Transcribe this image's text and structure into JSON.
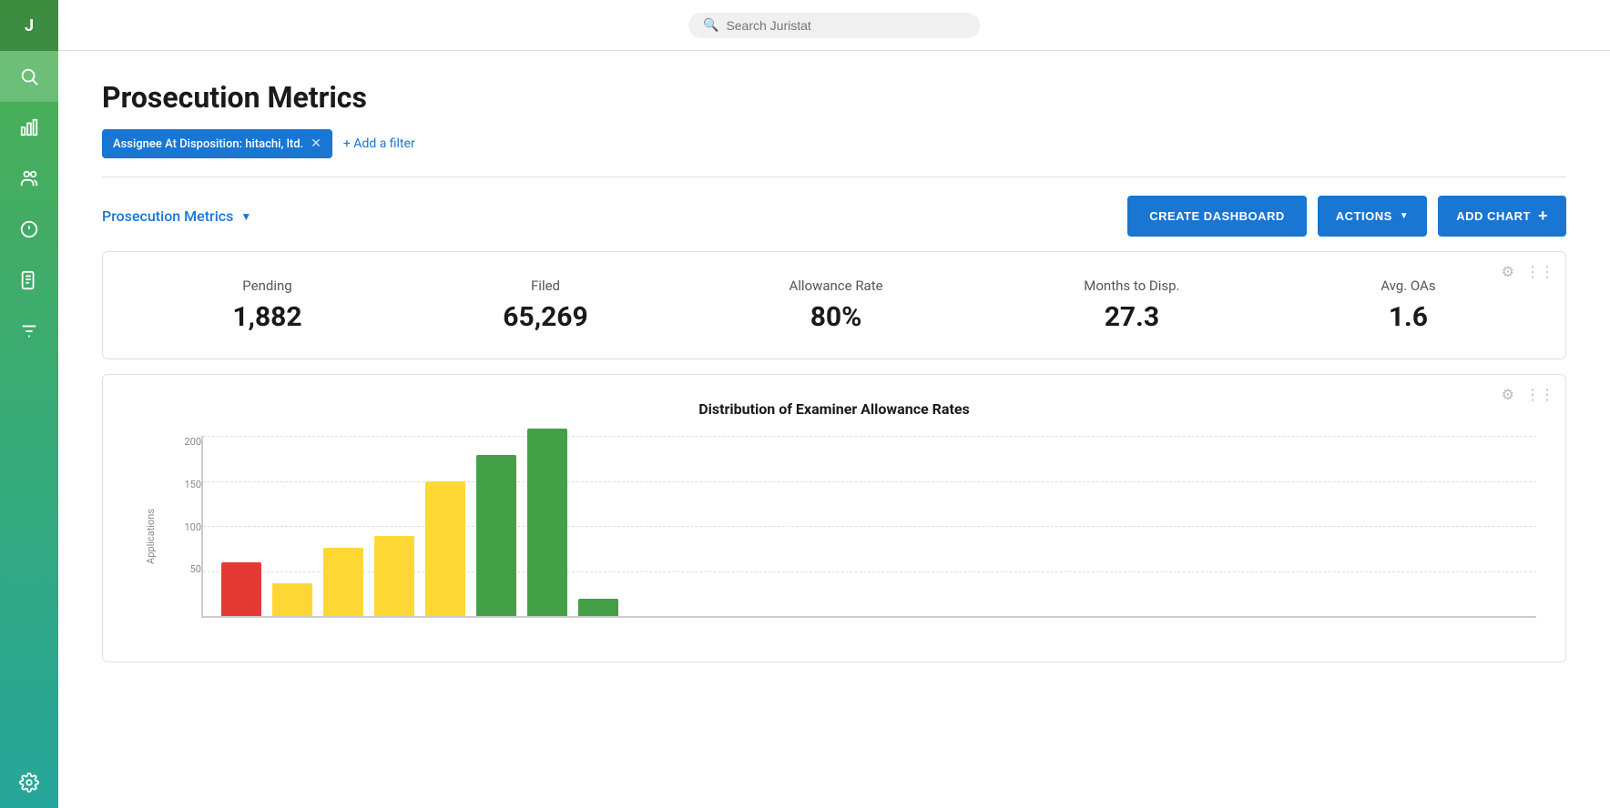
{
  "app": {
    "user_initial": "J"
  },
  "topbar": {
    "search_placeholder": "Search Juristat"
  },
  "page": {
    "title": "Prosecution Metrics"
  },
  "filters": {
    "active_filter_label": "Assignee At Disposition: hitachi, ltd.",
    "add_filter_label": "+ Add a filter"
  },
  "toolbar": {
    "tab_label": "Prosecution Metrics",
    "create_dashboard_label": "CREATE DASHBOARD",
    "actions_label": "ACTIONS",
    "add_chart_label": "ADD CHART"
  },
  "stats": {
    "pending_label": "Pending",
    "pending_value": "1,882",
    "filed_label": "Filed",
    "filed_value": "65,269",
    "allowance_rate_label": "Allowance Rate",
    "allowance_rate_value": "80%",
    "months_label": "Months to Disp.",
    "months_value": "27.3",
    "avg_oas_label": "Avg. OAs",
    "avg_oas_value": "1.6"
  },
  "chart": {
    "title": "Distribution of Examiner Allowance Rates",
    "y_axis_label": "Applications",
    "y_axis_values": [
      "200",
      "150",
      "100",
      "50"
    ],
    "bars": [
      {
        "height_pct": 62,
        "color": "red"
      },
      {
        "height_pct": 38,
        "color": "yellow"
      },
      {
        "height_pct": 78,
        "color": "yellow"
      },
      {
        "height_pct": 92,
        "color": "yellow"
      },
      {
        "height_pct": 155,
        "color": "yellow"
      },
      {
        "height_pct": 185,
        "color": "green"
      },
      {
        "height_pct": 215,
        "color": "green"
      },
      {
        "height_pct": 20,
        "color": "green"
      }
    ]
  },
  "sidebar": {
    "icons": [
      "search",
      "chart",
      "people",
      "lightbulb",
      "document",
      "sliders",
      "settings"
    ]
  }
}
